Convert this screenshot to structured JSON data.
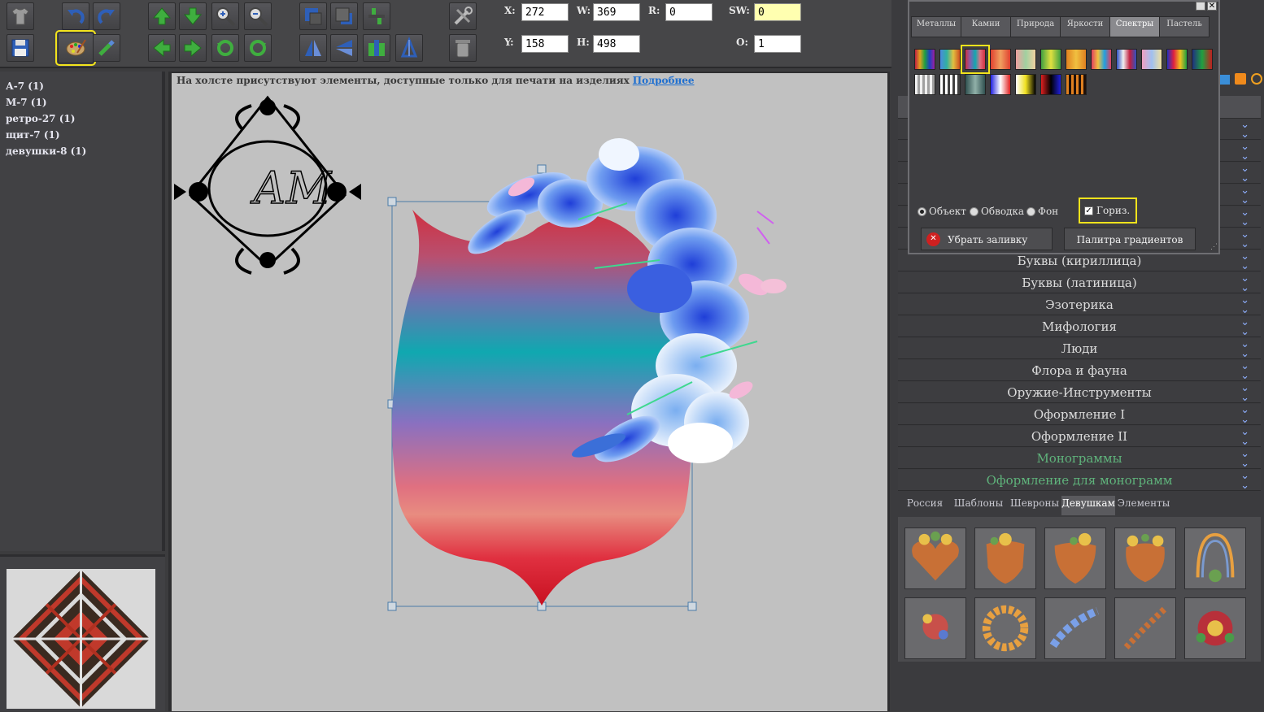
{
  "toolbar": {
    "x_label": "X:",
    "x_value": "272",
    "y_label": "Y:",
    "y_value": "158",
    "w_label": "W:",
    "w_value": "369",
    "h_label": "H:",
    "h_value": "498",
    "r_label": "R:",
    "r_value": "0",
    "sw_label": "SW:",
    "sw_value": "0",
    "o_label": "O:",
    "o_value": "1"
  },
  "layers": [
    "А-7 (1)",
    "М-7 (1)",
    "ретро-27 (1)",
    "щит-7 (1)",
    "девушки-8 (1)"
  ],
  "canvas": {
    "notice": "На холсте присутствуют элементы, доступные только для печати на изделиях",
    "more_link": "Подробнее"
  },
  "gradient_popup": {
    "tabs": [
      "Металлы",
      "Камни",
      "Природа",
      "Яркости",
      "Спектры",
      "Пастель"
    ],
    "active_tab": "Спектры",
    "radio_object": "Объект",
    "radio_stroke": "Обводка",
    "radio_background": "Фон",
    "horizontal_checkbox": "Гориз.",
    "remove_fill_button": "Убрать заливку",
    "gradient_palette_button": "Палитра градиентов"
  },
  "categories": [
    {
      "label": "Буквы (кириллица)",
      "color": "#dcdcdc"
    },
    {
      "label": "Буквы (латиница)",
      "color": "#dcdcdc"
    },
    {
      "label": "Эзотерика",
      "color": "#dcdcdc"
    },
    {
      "label": "Мифология",
      "color": "#dcdcdc"
    },
    {
      "label": "Люди",
      "color": "#dcdcdc"
    },
    {
      "label": "Флора и фауна",
      "color": "#dcdcdc"
    },
    {
      "label": "Оружие-Инструменты",
      "color": "#dcdcdc"
    },
    {
      "label": "Оформление I",
      "color": "#dcdcdc"
    },
    {
      "label": "Оформление II",
      "color": "#dcdcdc"
    },
    {
      "label": "Монограммы",
      "color": "#5fb37b"
    },
    {
      "label": "Оформление для монограмм",
      "color": "#5fb37b"
    }
  ],
  "bottom_tabs": [
    "Россия",
    "Шаблоны",
    "Шевроны",
    "Девушкам",
    "Элементы"
  ],
  "active_bottom_tab": "Девушкам",
  "monogram": "АМ"
}
